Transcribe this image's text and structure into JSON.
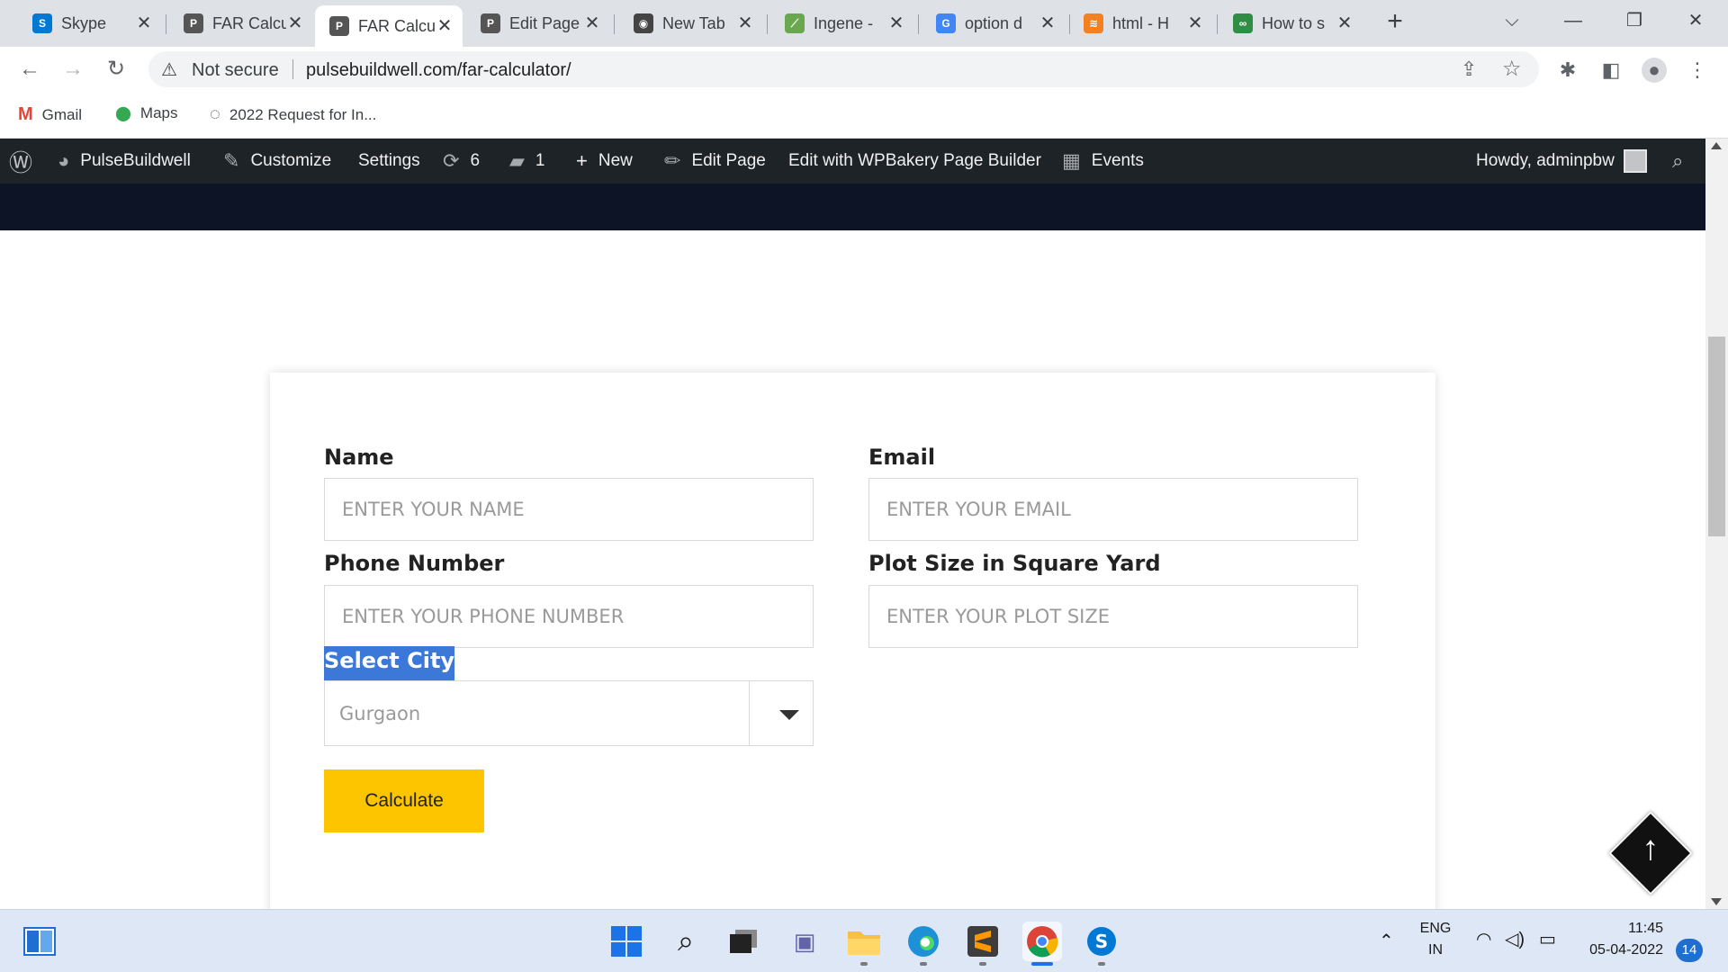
{
  "browser": {
    "tabs": [
      {
        "title": "Skype",
        "favicon": "S",
        "color": "#0078d4"
      },
      {
        "title": "FAR Calcu",
        "favicon": "P",
        "color": "#555555"
      },
      {
        "title": "FAR Calcu",
        "favicon": "P",
        "color": "#555555",
        "active": true
      },
      {
        "title": "Edit Page",
        "favicon": "P",
        "color": "#555555"
      },
      {
        "title": "New Tab",
        "favicon": "◉",
        "color": "#444444"
      },
      {
        "title": "Ingene -",
        "favicon": "⟋",
        "color": "#6aa84f"
      },
      {
        "title": "option d",
        "favicon": "G",
        "color": "#4285f4"
      },
      {
        "title": "html - H",
        "favicon": "≋",
        "color": "#f48024"
      },
      {
        "title": "How to s",
        "favicon": "∞",
        "color": "#2f8d46"
      }
    ],
    "tab_close": "✕",
    "new_tab": "+",
    "address": {
      "security_label": "Not secure",
      "url": "pulsebuildwell.com/far-calculator/"
    },
    "bookmarks": [
      {
        "label": "Gmail",
        "icon": "M",
        "color": "#ea4335"
      },
      {
        "label": "Maps",
        "icon": "⬤",
        "color": "#34a853"
      },
      {
        "label": "2022 Request for In...",
        "icon": "◌",
        "color": "#3c4043"
      }
    ]
  },
  "adminbar": {
    "site": "PulseBuildwell",
    "customize": "Customize",
    "settings": "Settings",
    "updates_count": "6",
    "comments_count": "1",
    "new": "New",
    "edit_page": "Edit Page",
    "wpbakery": "Edit with WPBakery Page Builder",
    "events": "Events",
    "howdy": "Howdy, adminpbw"
  },
  "form": {
    "name_label": "Name",
    "name_placeholder": "ENTER YOUR NAME",
    "email_label": "Email",
    "email_placeholder": "ENTER YOUR EMAIL",
    "phone_label": "Phone Number",
    "phone_placeholder": "ENTER YOUR PHONE NUMBER",
    "plot_label": "Plot Size in Square Yard",
    "plot_placeholder": "ENTER YOUR PLOT SIZE",
    "city_label": "Select City",
    "city_value": "Gurgaon",
    "calculate_label": "Calculate"
  },
  "scroll_top_arrow": "↑",
  "taskbar": {
    "language": "ENG",
    "region": "IN",
    "time": "11:45",
    "date": "05-04-2022",
    "notifications": "14"
  }
}
